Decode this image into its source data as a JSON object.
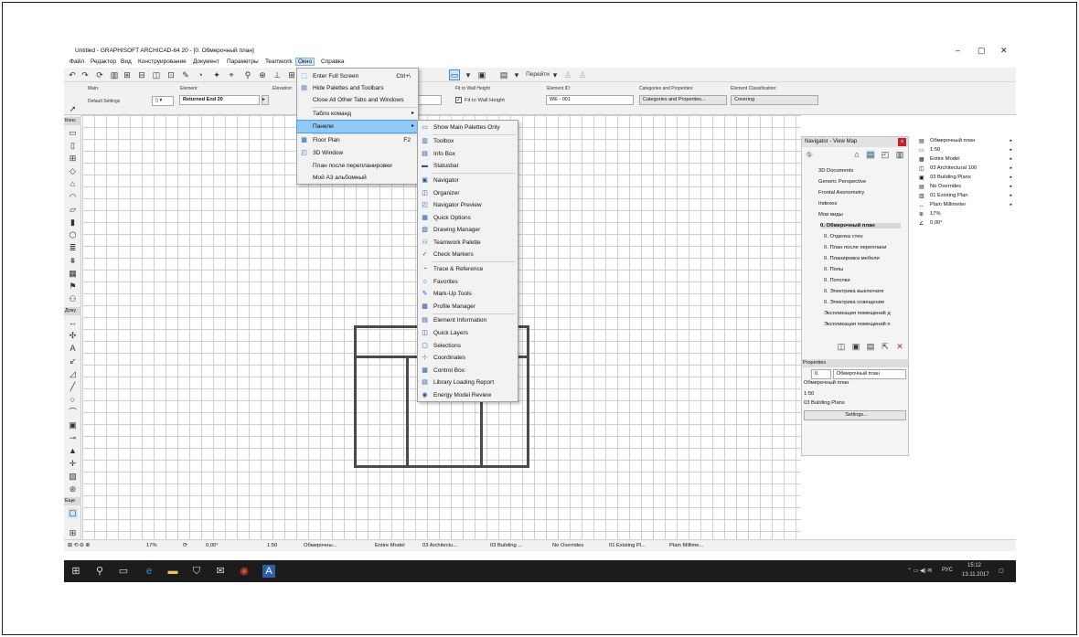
{
  "window": {
    "title": "Untitled - GRAPHISOFT ARCHICAD-64 20 - [0. Обмерочный план]"
  },
  "menubar": [
    "Файл",
    "Редактор",
    "Вид",
    "Конструирование",
    "Документ",
    "Параметры",
    "Teamwork",
    "Окно",
    "Справка"
  ],
  "toolbar": {
    "goto_label": "Перейти"
  },
  "infobox": {
    "main_label": "Main:",
    "default_settings": "Default Settings",
    "element_label": "Element:",
    "element_value": "Returned End 20",
    "elevation_label": "Elevation:",
    "fit_label": "Fit to Wall Height",
    "fit_check_label": "Fit to Wall Height",
    "element_id_label": "Element ID:",
    "element_id_value": "WE - 001",
    "categories_label": "Categories and Properties:",
    "categories_value": "Categories and Properties...",
    "classification_label": "Element Classification:",
    "classification_value": "Covering"
  },
  "left_toolbox": {
    "section_design": "Конс",
    "section_document": "Доку",
    "section_more": "Еще"
  },
  "window_menu": {
    "items": [
      {
        "label": "Enter Full Screen",
        "shortcut": "Ctrl+\\"
      },
      {
        "label": "Hide Palettes and Toolbars"
      },
      {
        "label": "Close All Other Tabs and Windows"
      },
      {
        "label": "Табло команд"
      },
      {
        "label": "Панели"
      },
      {
        "label": "Floor Plan",
        "shortcut": "F2"
      },
      {
        "label": "3D Window"
      },
      {
        "label": "План после перепланировки"
      },
      {
        "label": "Мой А3 альбомный"
      }
    ]
  },
  "palettes_submenu": {
    "items": [
      "Show Main Palettes Only",
      "Toolbox",
      "Info Box",
      "Statusbar",
      "Navigator",
      "Organizer",
      "Navigator Preview",
      "Quick Options",
      "Drawing Manager",
      "Teamwork Palette",
      "Check Markers",
      "Trace & Reference",
      "Favorites",
      "Mark-Up Tools",
      "Profile Manager",
      "Element Information",
      "Quick Layers",
      "Selections",
      "Coordinates",
      "Control Box",
      "Library Loading Report",
      "Energy Model Review"
    ]
  },
  "navigator": {
    "title": "Navigator - View Map",
    "tree": [
      "3D Documents",
      "Generic Perspective",
      "Frontal Axonometry",
      "Indexes",
      "Мои виды",
      "0. Обмерочный план",
      "0. Отделка стен",
      "0. План после переплани",
      "0. Планировка мебели",
      "0. Полы",
      "0. Потолки",
      "0. Электрика выключате",
      "0. Электрика освещение",
      "Экспликация помещений д",
      "Экспликация помещений п"
    ],
    "properties_label": "Properties",
    "prop_id": "0.",
    "prop_name": "Обмерочный план",
    "prop_view": "Обмерочный план",
    "prop_scale": "1:50",
    "prop_layer": "03 Building Plans",
    "settings_button": "Settings..."
  },
  "right_panel": [
    "Обмерочный план",
    "1:50",
    "Entire Model",
    "03 Architectural 100",
    "03 Building Plans",
    "No Overrides",
    "01 Existing Plan",
    "Plain Millimeter",
    "17%",
    "0,00°"
  ],
  "statusbar": {
    "zoom": "17%",
    "angle": "0,00°",
    "scale": "1:50",
    "view": "Обмерочны...",
    "model": "Entire Model",
    "layer": "03 Architectu...",
    "plans": "03 Building ...",
    "overrides": "No Overrides",
    "existing": "01 Existing Pl...",
    "dims": "Plain Millime..."
  },
  "taskbar": {
    "lang": "РУС",
    "time": "15:12",
    "date": "13.11.2017"
  },
  "colors": {
    "accent": "#91c9f7",
    "close": "#c8202e",
    "taskbar": "#1c1c1c"
  }
}
